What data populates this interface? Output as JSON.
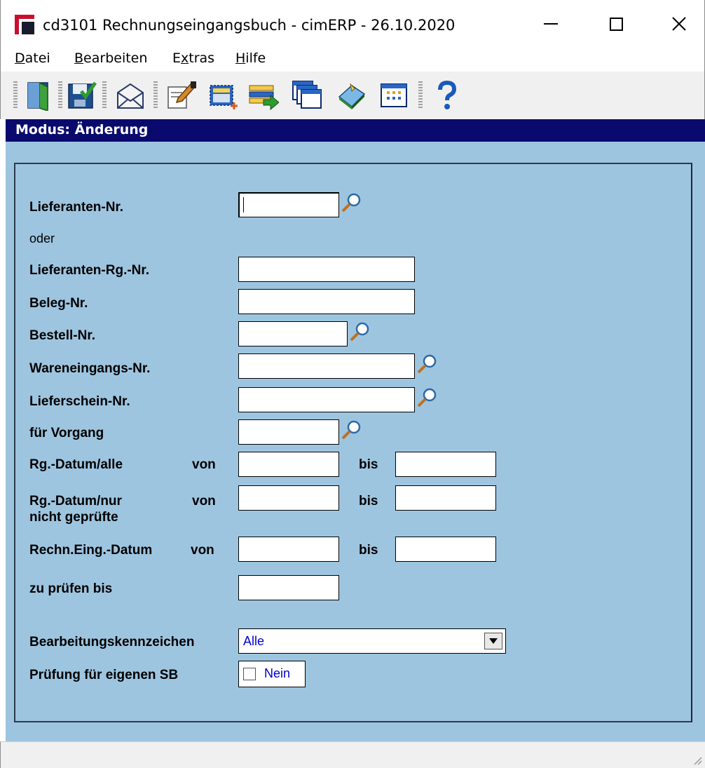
{
  "window": {
    "title": "cd3101 Rechnungseingangsbuch - cimERP - 26.10.2020"
  },
  "menu": [
    {
      "label": "Datei",
      "accel": "D",
      "rest": "atei"
    },
    {
      "label": "Bearbeiten",
      "accel": "B",
      "rest": "earbeiten"
    },
    {
      "label": "Extras",
      "pre": "E",
      "accel": "x",
      "rest": "tras"
    },
    {
      "label": "Hilfe",
      "accel": "H",
      "rest": "ilfe"
    }
  ],
  "toolbar": {
    "icons": [
      "exit-door-icon",
      "save-icon",
      "mail-icon",
      "edit-document-icon",
      "new-selection-icon",
      "list-transfer-icon",
      "windows-icon",
      "book-icon",
      "table-icon",
      "help-icon"
    ]
  },
  "mode": {
    "text": "Modus: Änderung"
  },
  "form": {
    "lieferanten_nr": "Lieferanten-Nr.",
    "oder": "oder",
    "lieferanten_rg_nr": "Lieferanten-Rg.-Nr.",
    "beleg_nr": "Beleg-Nr.",
    "bestell_nr": "Bestell-Nr.",
    "wareneingangs_nr": "Wareneingangs-Nr.",
    "lieferschein_nr": "Lieferschein-Nr.",
    "fuer_vorgang": "für Vorgang",
    "rg_datum_alle": "Rg.-Datum/alle",
    "rg_datum_nur_1": "Rg.-Datum/nur",
    "rg_datum_nur_2": "nicht geprüfte",
    "rechn_eing_datum": "Rechn.Eing.-Datum",
    "von": "von",
    "bis": "bis",
    "zu_pruefen_bis": "zu prüfen bis",
    "bearbeitungskennzeichen": "Bearbeitungskennzeichen",
    "bearbeitungskennzeichen_value": "Alle",
    "pruefung_eigener_sb": "Prüfung für eigenen SB",
    "pruefung_value": "Nein"
  }
}
